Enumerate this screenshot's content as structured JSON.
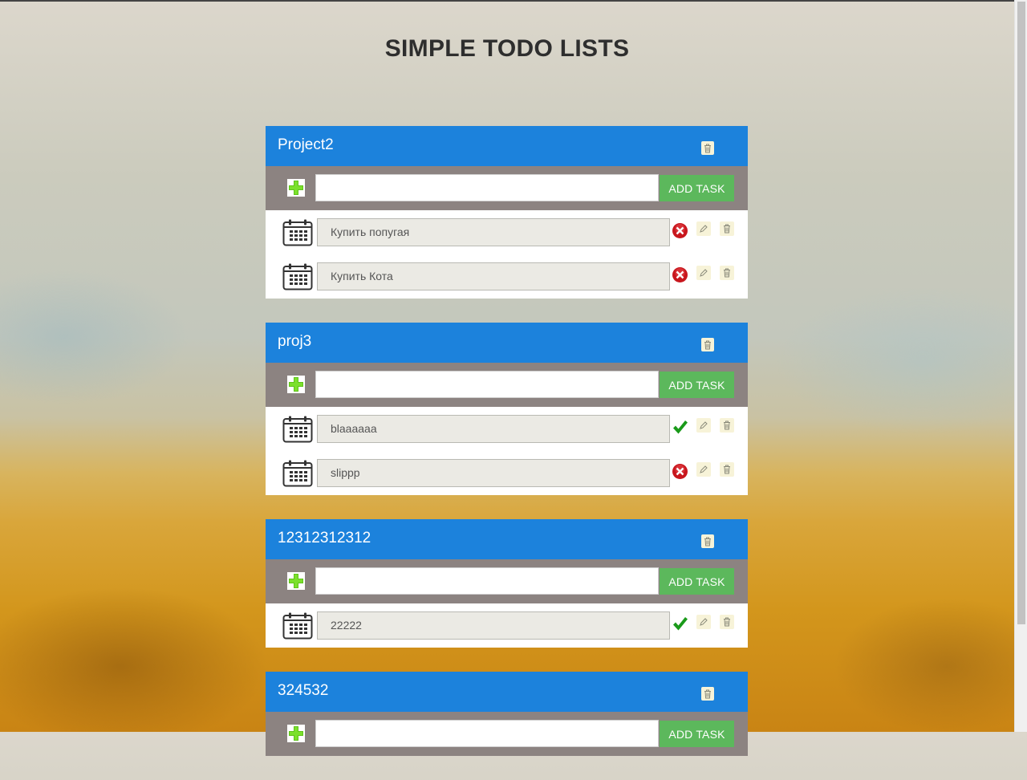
{
  "page": {
    "title": "SIMPLE TODO LISTS"
  },
  "projects": [
    {
      "name": "Project2",
      "add_button": "ADD TASK",
      "input_value": "",
      "tasks": [
        {
          "text": "Купить попугая",
          "status": "not-done"
        },
        {
          "text": "Купить Кота",
          "status": "not-done"
        }
      ]
    },
    {
      "name": "proj3",
      "add_button": "ADD TASK",
      "input_value": "",
      "tasks": [
        {
          "text": "blaaaaaa",
          "status": "done"
        },
        {
          "text": "slippp",
          "status": "not-done"
        }
      ]
    },
    {
      "name": "12312312312",
      "add_button": "ADD TASK",
      "input_value": "",
      "tasks": [
        {
          "text": "22222",
          "status": "done"
        }
      ]
    },
    {
      "name": "324532",
      "add_button": "ADD TASK",
      "input_value": "",
      "tasks": []
    }
  ],
  "colors": {
    "header_blue": "#1c82dc",
    "add_row_gray": "#8c8381",
    "add_button_green": "#5cb85c",
    "done_green": "#1a9a1a",
    "not_done_red": "#c8161d"
  },
  "icons": {
    "project_delete": "trash-icon",
    "add": "plus-icon",
    "task_deadline": "calendar-icon",
    "status_done": "checkmark-icon",
    "status_not_done": "x-circle-icon",
    "edit": "pencil-icon",
    "delete": "trash-icon"
  }
}
